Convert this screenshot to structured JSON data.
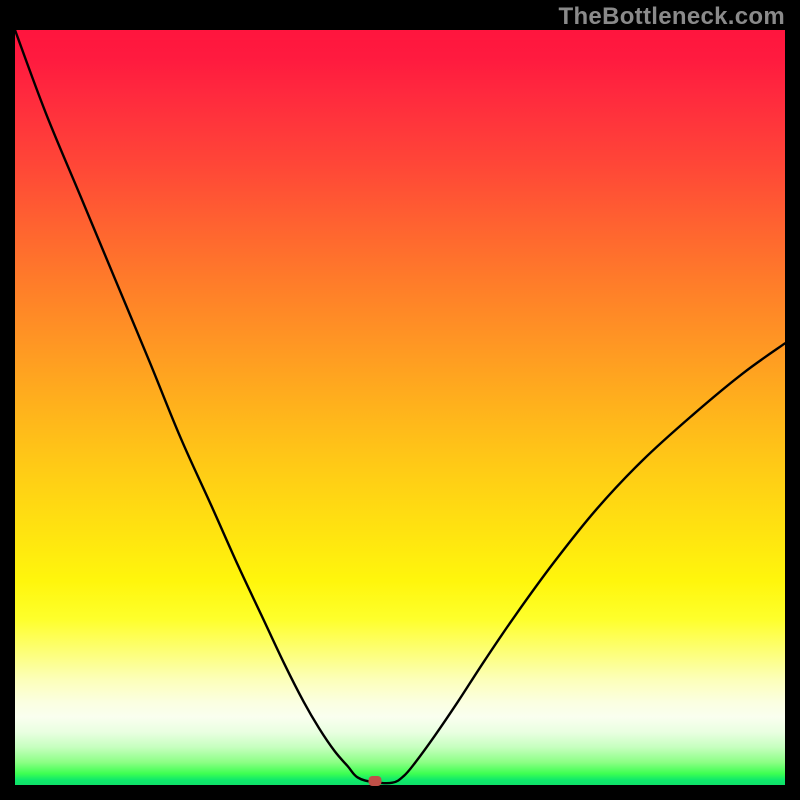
{
  "watermark": "TheBottleneck.com",
  "marker": {
    "x": 0.4675,
    "y_pct": 0
  },
  "chart_data": {
    "type": "line",
    "title": "",
    "xlabel": "",
    "ylabel": "",
    "xlim": [
      0,
      1
    ],
    "ylim": [
      0,
      100
    ],
    "series": [
      {
        "name": "curve",
        "x": [
          0.0,
          0.04,
          0.085,
          0.13,
          0.175,
          0.215,
          0.255,
          0.29,
          0.32,
          0.35,
          0.375,
          0.395,
          0.415,
          0.432,
          0.445,
          0.465,
          0.49,
          0.505,
          0.52,
          0.545,
          0.575,
          0.61,
          0.65,
          0.7,
          0.755,
          0.815,
          0.88,
          0.945,
          1.0
        ],
        "y_pct": [
          100.0,
          89.0,
          78.0,
          67.0,
          56.0,
          46.0,
          37.0,
          29.0,
          22.5,
          16.0,
          11.0,
          7.5,
          4.5,
          2.5,
          1.0,
          0.4,
          0.3,
          1.2,
          3.0,
          6.5,
          11.0,
          16.5,
          22.5,
          29.5,
          36.5,
          43.0,
          49.0,
          54.5,
          58.5
        ]
      }
    ],
    "marker": {
      "x": 0.4675,
      "y_pct": 0
    },
    "background_gradient": "red-yellow-green vertical"
  }
}
